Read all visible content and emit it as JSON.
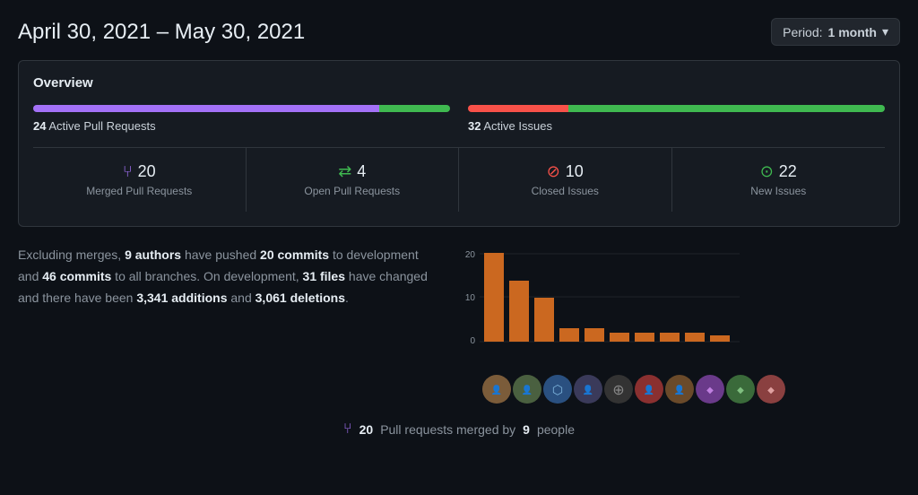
{
  "header": {
    "title": "April 30, 2021 – May 30, 2021",
    "period_label": "Period:",
    "period_value": "1 month",
    "period_chevron": "▾"
  },
  "overview": {
    "title": "Overview",
    "pull_requests": {
      "label_prefix": "24",
      "label": "Active Pull Requests",
      "bar_purple_pct": 83,
      "bar_green_pct": 17
    },
    "issues": {
      "label_prefix": "32",
      "label": "Active Issues",
      "bar_red_pct": 24,
      "bar_green_pct": 76
    },
    "stats": [
      {
        "id": "merged-pr",
        "icon": "⑂",
        "icon_class": "icon-merged",
        "value": "20",
        "label": "Merged Pull Requests"
      },
      {
        "id": "open-pr",
        "icon": "⇄",
        "icon_class": "icon-open",
        "value": "4",
        "label": "Open Pull Requests"
      },
      {
        "id": "closed-issues",
        "icon": "⊘",
        "icon_class": "icon-closed",
        "value": "10",
        "label": "Closed Issues"
      },
      {
        "id": "new-issues",
        "icon": "⊙",
        "icon_class": "icon-new",
        "value": "22",
        "label": "New Issues"
      }
    ]
  },
  "summary": {
    "text_parts": {
      "intro": "Excluding merges, ",
      "authors_count": "9 authors",
      "pushed": " have pushed ",
      "dev_commits": "20 commits",
      "to_dev": " to development and ",
      "all_commits": "46 commits",
      "to_all": " to all branches. On development, ",
      "files": "31 files",
      "changed": " have changed and there have been ",
      "additions": "3,341 additions",
      "and": " and ",
      "deletions": "3,061 deletions",
      "end": "."
    }
  },
  "chart": {
    "y_labels": [
      "20",
      "10",
      "0"
    ],
    "bars": [
      {
        "height": 100,
        "label": ""
      },
      {
        "height": 72,
        "label": ""
      },
      {
        "height": 50,
        "label": ""
      },
      {
        "height": 18,
        "label": ""
      },
      {
        "height": 20,
        "label": ""
      },
      {
        "height": 16,
        "label": ""
      },
      {
        "height": 15,
        "label": ""
      },
      {
        "height": 14,
        "label": ""
      },
      {
        "height": 14,
        "label": ""
      },
      {
        "height": 12,
        "label": ""
      }
    ],
    "bar_color": "#cb6820",
    "avatar_count": 10
  },
  "footer": {
    "icon": "⑂",
    "merged_count": "20",
    "text": "Pull requests merged by",
    "people_count": "9",
    "people_label": "people"
  }
}
